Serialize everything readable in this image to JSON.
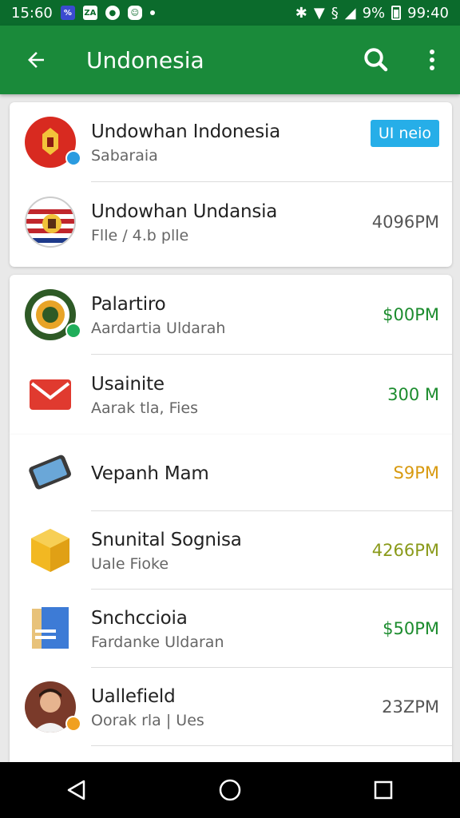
{
  "status_bar": {
    "time": "15:60",
    "icon1": "%",
    "icon2": "ZA",
    "battery_percent": "9%",
    "clock_right": "99:40"
  },
  "app_bar": {
    "title": "Undonesia",
    "back_icon": "arrow-left-icon",
    "search_icon": "search-icon",
    "menu_icon": "more-vert-icon"
  },
  "colors": {
    "status_bar": "#0b6b2c",
    "app_bar": "#1a8a3a",
    "green_meta": "#1c8c2e",
    "orange_meta": "#d89a10",
    "gray_meta": "#555555",
    "badge_blue": "#26aee8"
  },
  "card1": {
    "items": [
      {
        "title": "Undowhan Indonesia",
        "subtitle": "Sabaraia",
        "action": "UI neio"
      },
      {
        "title": "Undowhan Undansia",
        "subtitle": "Flle / 4.b plle",
        "meta": "4096PM"
      }
    ]
  },
  "card2": {
    "items": [
      {
        "title": "Palartiro",
        "subtitle": "Aardartia Uldarah",
        "meta": "$00PM"
      },
      {
        "title": "Usainite",
        "subtitle": "Aarak tla, Fies",
        "meta": "300 M"
      }
    ]
  },
  "card3": {
    "items": [
      {
        "title": "Vepanh Mam",
        "subtitle": "",
        "meta": "S9PM"
      },
      {
        "title": "Snunital Sognisa",
        "subtitle": "Uale Fioke",
        "meta": "4266PM"
      },
      {
        "title": "Snchccioia",
        "subtitle": "Fardanke Uldaran",
        "meta": "$50PM"
      },
      {
        "title": "Uallefield",
        "subtitle": "Oorak rla | Ues",
        "meta": "23ZPM"
      }
    ]
  },
  "nav_bar": {
    "back": "triangle-back-icon",
    "home": "circle-home-icon",
    "recents": "square-recents-icon"
  }
}
